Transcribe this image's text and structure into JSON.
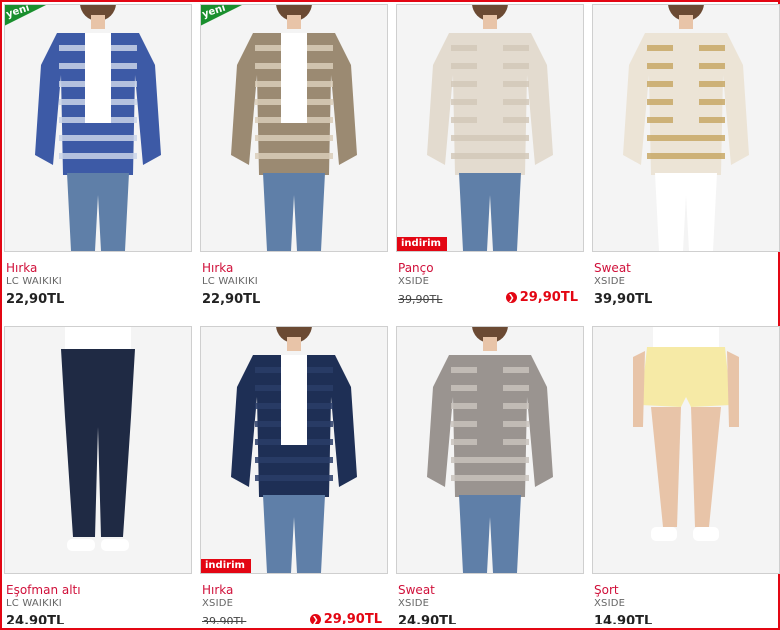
{
  "products": [
    {
      "name": "Hırka",
      "brand": "LC WAIKIKI",
      "price": "22,90TL",
      "badge": "yeni",
      "garment": "blue striped open cardigan",
      "colors": {
        "garment": "#3d5aa6",
        "stripe": "#c9d3e8",
        "bg": "#f4f4f4"
      }
    },
    {
      "name": "Hırka",
      "brand": "LC WAIKIKI",
      "price": "22,90TL",
      "badge": "yeni",
      "garment": "beige striped open cardigan",
      "colors": {
        "garment": "#9b8a72",
        "stripe": "#d9cdb8",
        "bg": "#f4f4f4"
      }
    },
    {
      "name": "Panço",
      "brand": "XSIDE",
      "old_price": "39,90TL",
      "price": "29,90TL",
      "badge": "indirim",
      "garment": "cream hooded poncho",
      "colors": {
        "garment": "#e3dbcf",
        "stripe": "#d2c8b8",
        "bg": "#f4f4f4"
      }
    },
    {
      "name": "Sweat",
      "brand": "XSIDE",
      "price": "39,90TL",
      "garment": "cream sweat with gold stripes",
      "colors": {
        "garment": "#ece4d6",
        "stripe": "#c8a866",
        "bg": "#f4f4f4"
      }
    },
    {
      "name": "Eşofman altı",
      "brand": "LC WAIKIKI",
      "price": "24,90TL",
      "garment": "navy sweatpants",
      "colors": {
        "garment": "#1f2a44",
        "stripe": "#2c3858",
        "bg": "#f4f4f4"
      }
    },
    {
      "name": "Hırka",
      "brand": "XSIDE",
      "old_price": "39,90TL",
      "price": "29,90TL",
      "badge": "indirim",
      "garment": "navy blazer-style cardigan",
      "colors": {
        "garment": "#1e2f55",
        "stripe": "#2a3d69",
        "bg": "#f4f4f4"
      }
    },
    {
      "name": "Sweat",
      "brand": "XSIDE",
      "price": "24,90TL",
      "garment": "grey striped batwing top",
      "colors": {
        "garment": "#9a9490",
        "stripe": "#c8c2bc",
        "bg": "#f4f4f4"
      }
    },
    {
      "name": "Şort",
      "brand": "XSIDE",
      "price": "14,90TL",
      "garment": "light yellow shorts",
      "colors": {
        "garment": "#f6eaa6",
        "stripe": "#efe08a",
        "bg": "#f4f4f4"
      }
    }
  ],
  "colors": {
    "accent": "#e30613",
    "name": "#d0103a",
    "ribbon": "#1a8f2e",
    "skin": "#e8c4a8",
    "hair": "#6b4a33",
    "jeans": "#5f7fa8",
    "white": "#ffffff"
  }
}
